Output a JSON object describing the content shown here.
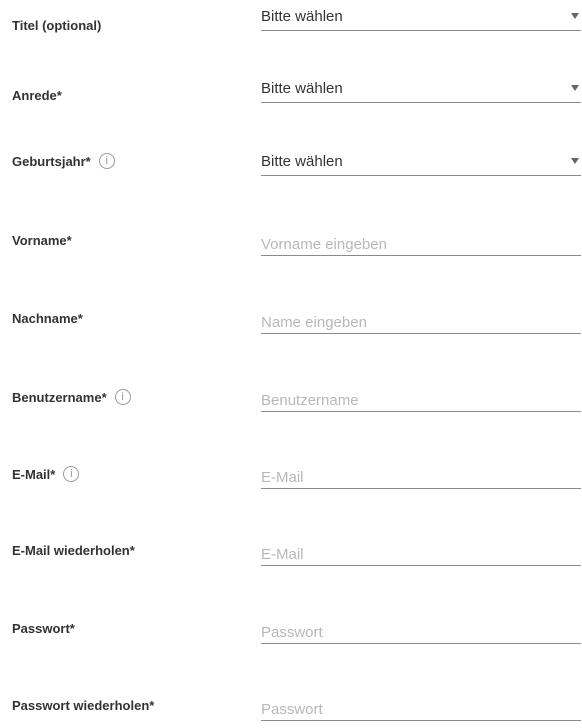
{
  "form": {
    "title_field": {
      "label": "Titel (optional)",
      "value": "Bitte wählen"
    },
    "salutation_field": {
      "label": "Anrede*",
      "value": "Bitte wählen"
    },
    "birth_year_field": {
      "label": "Geburtsjahr*",
      "value": "Bitte wählen",
      "info_icon": "info-icon"
    },
    "first_name_field": {
      "label": "Vorname*",
      "placeholder": "Vorname eingeben"
    },
    "last_name_field": {
      "label": "Nachname*",
      "placeholder": "Name eingeben"
    },
    "username_field": {
      "label": "Benutzername*",
      "placeholder": "Benutzername",
      "info_icon": "info-icon"
    },
    "email_field": {
      "label": "E-Mail*",
      "placeholder": "E-Mail",
      "info_icon": "info-icon"
    },
    "email_repeat_field": {
      "label": "E-Mail wiederholen*",
      "placeholder": "E-Mail"
    },
    "password_field": {
      "label": "Passwort*",
      "placeholder": "Passwort"
    },
    "password_repeat_field": {
      "label": "Passwort wiederholen*",
      "placeholder": "Passwort"
    }
  },
  "icons": {
    "info_glyph": "i",
    "caret": "caret-down-icon"
  },
  "colors": {
    "label": "#333333",
    "placeholder": "#b8b8b8",
    "underline": "#8a8a8a",
    "icon": "#9a9a9a"
  }
}
